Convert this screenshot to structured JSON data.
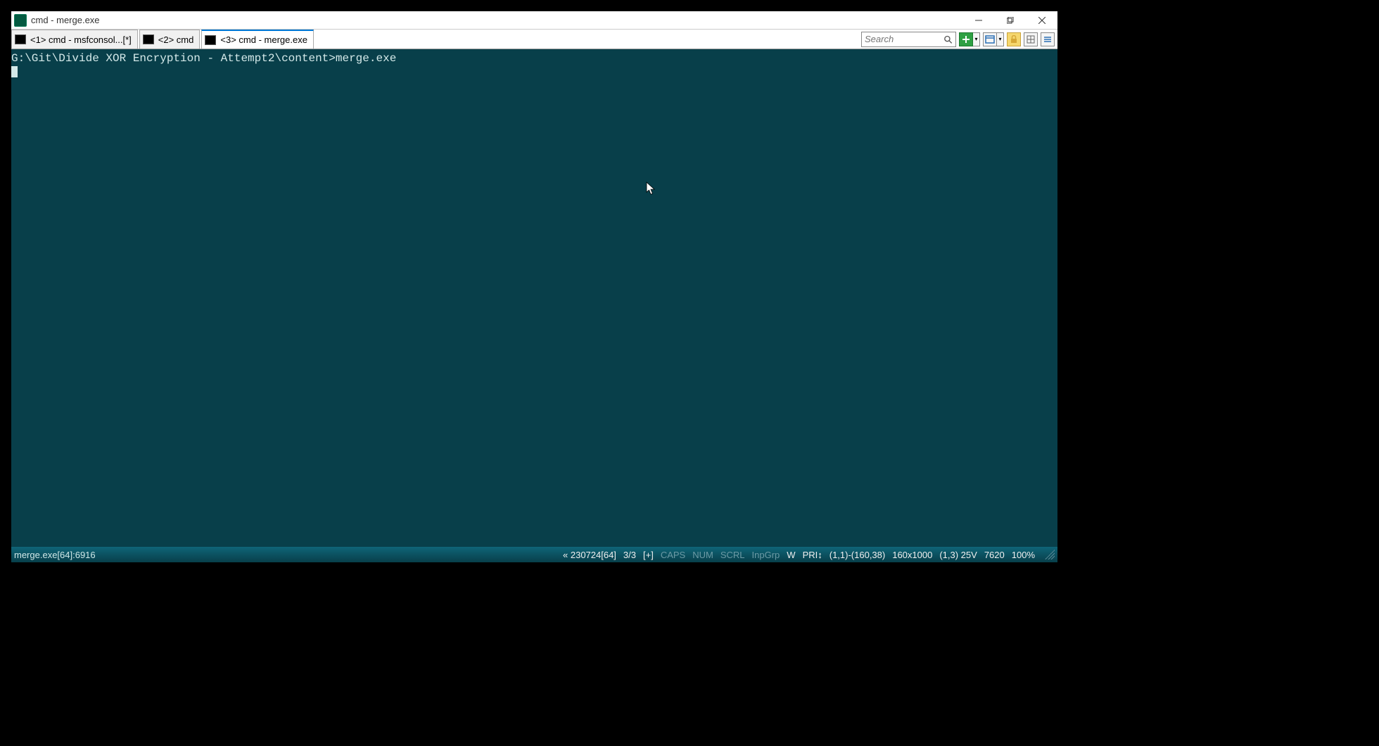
{
  "titlebar": {
    "title": "cmd - merge.exe"
  },
  "tabs": [
    {
      "label": "<1> cmd - msfconsol...[*]",
      "active": false
    },
    {
      "label": "<2> cmd",
      "active": false
    },
    {
      "label": "<3> cmd - merge.exe",
      "active": true
    }
  ],
  "search": {
    "placeholder": "Search"
  },
  "terminal": {
    "prompt_line": "G:\\Git\\Divide XOR Encryption - Attempt2\\content>merge.exe"
  },
  "statusbar": {
    "left": "merge.exe[64]:6916",
    "history": "« 230724[64]",
    "tab_count": "3/3",
    "plus": "[+]",
    "caps": "CAPS",
    "num": "NUM",
    "scrl": "SCRL",
    "inpgrp": "InpGrp",
    "mode_w": "W",
    "pri": "PRI↕",
    "selection": "(1,1)-(160,38)",
    "dimensions": "160x1000",
    "cursor_pos": "(1,3) 25V",
    "pid": "7620",
    "zoom": "100%"
  }
}
